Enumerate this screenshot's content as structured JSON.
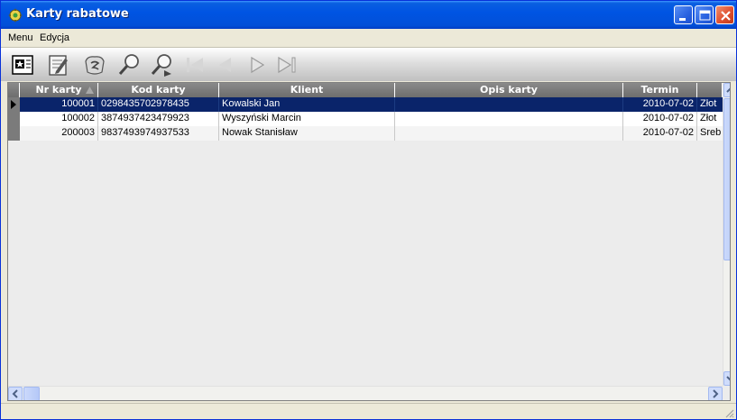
{
  "window": {
    "title": "Karty rabatowe",
    "title_icon": "gear-icon"
  },
  "menu": {
    "items": [
      "Menu",
      "Edycja"
    ]
  },
  "toolbar": {
    "icons": [
      "add-record-icon",
      "edit-record-icon",
      "delete-record-icon",
      "search-icon",
      "search-next-icon",
      "first-record-icon",
      "previous-record-icon",
      "next-record-icon",
      "last-record-icon"
    ]
  },
  "grid": {
    "columns": [
      "Nr karty",
      "Kod karty",
      "Klient",
      "Opis karty",
      "Termin ważn."
    ],
    "rows": [
      {
        "nr": "100001",
        "kod": "0298435702978435",
        "klient": "Kowalski Jan",
        "opis": "",
        "termin": "2010-07-02",
        "extra": "Złot"
      },
      {
        "nr": "100002",
        "kod": "3874937423479923",
        "klient": "Wyszyński Marcin",
        "opis": "",
        "termin": "2010-07-02",
        "extra": "Złot"
      },
      {
        "nr": "200003",
        "kod": "9837493974937533",
        "klient": "Nowak Stanisław",
        "opis": "",
        "termin": "2010-07-02",
        "extra": "Sreb"
      }
    ],
    "selected_row": 0,
    "sort_column": "Nr karty",
    "sort_direction": "ascending"
  },
  "colors": {
    "titlebar": "#0054e3",
    "selection": "#0a246a",
    "header": "#7b7b7b"
  }
}
